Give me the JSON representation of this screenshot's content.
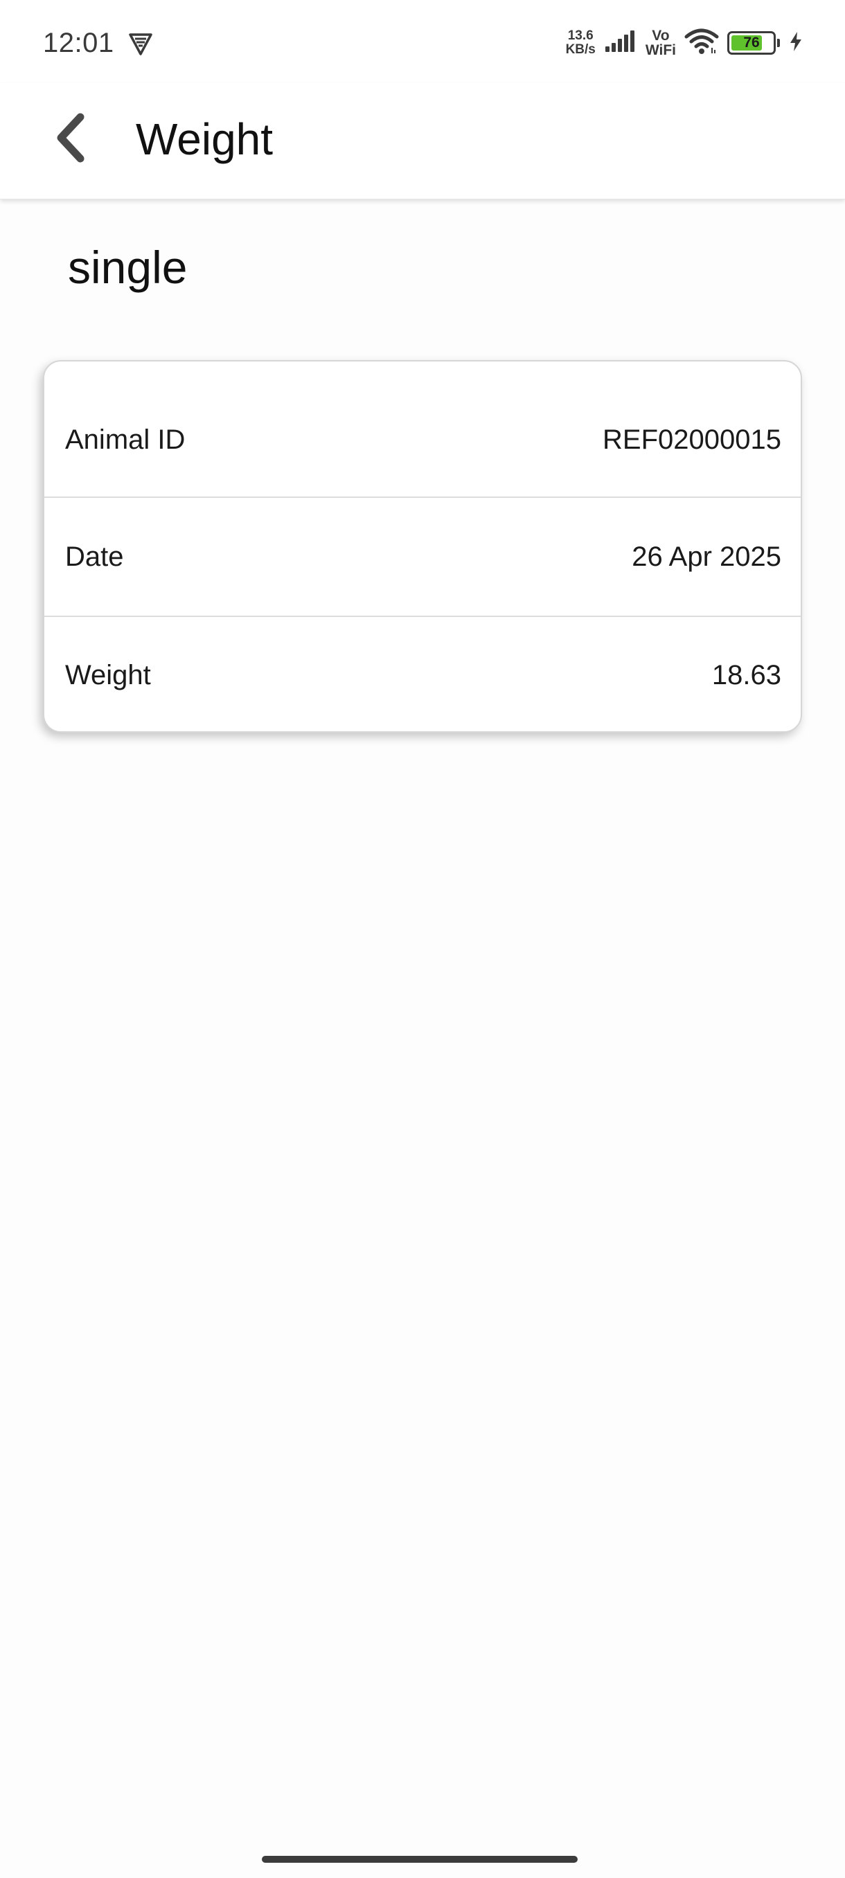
{
  "status_bar": {
    "time": "12:01",
    "net_speed_value": "13.6",
    "net_speed_unit": "KB/s",
    "vowifi_top": "Vo",
    "vowifi_bottom": "WiFi",
    "battery_level": "76",
    "battery_fraction": 0.76,
    "icons": [
      "vpn-shield-icon",
      "signal-icon",
      "wifi-icon",
      "battery-icon",
      "charging-bolt-icon"
    ]
  },
  "app_bar": {
    "title": "Weight",
    "back_icon": "chevron-left-icon"
  },
  "section": {
    "label": "single"
  },
  "details": {
    "rows": [
      {
        "label": "Animal ID",
        "value": "REF02000015"
      },
      {
        "label": "Date",
        "value": "26 Apr 2025"
      },
      {
        "label": "Weight",
        "value": "18.63"
      }
    ]
  },
  "colors": {
    "battery_fill": "#5fc22c",
    "background": "#fdfdfd",
    "divider": "#dcdcdc"
  }
}
